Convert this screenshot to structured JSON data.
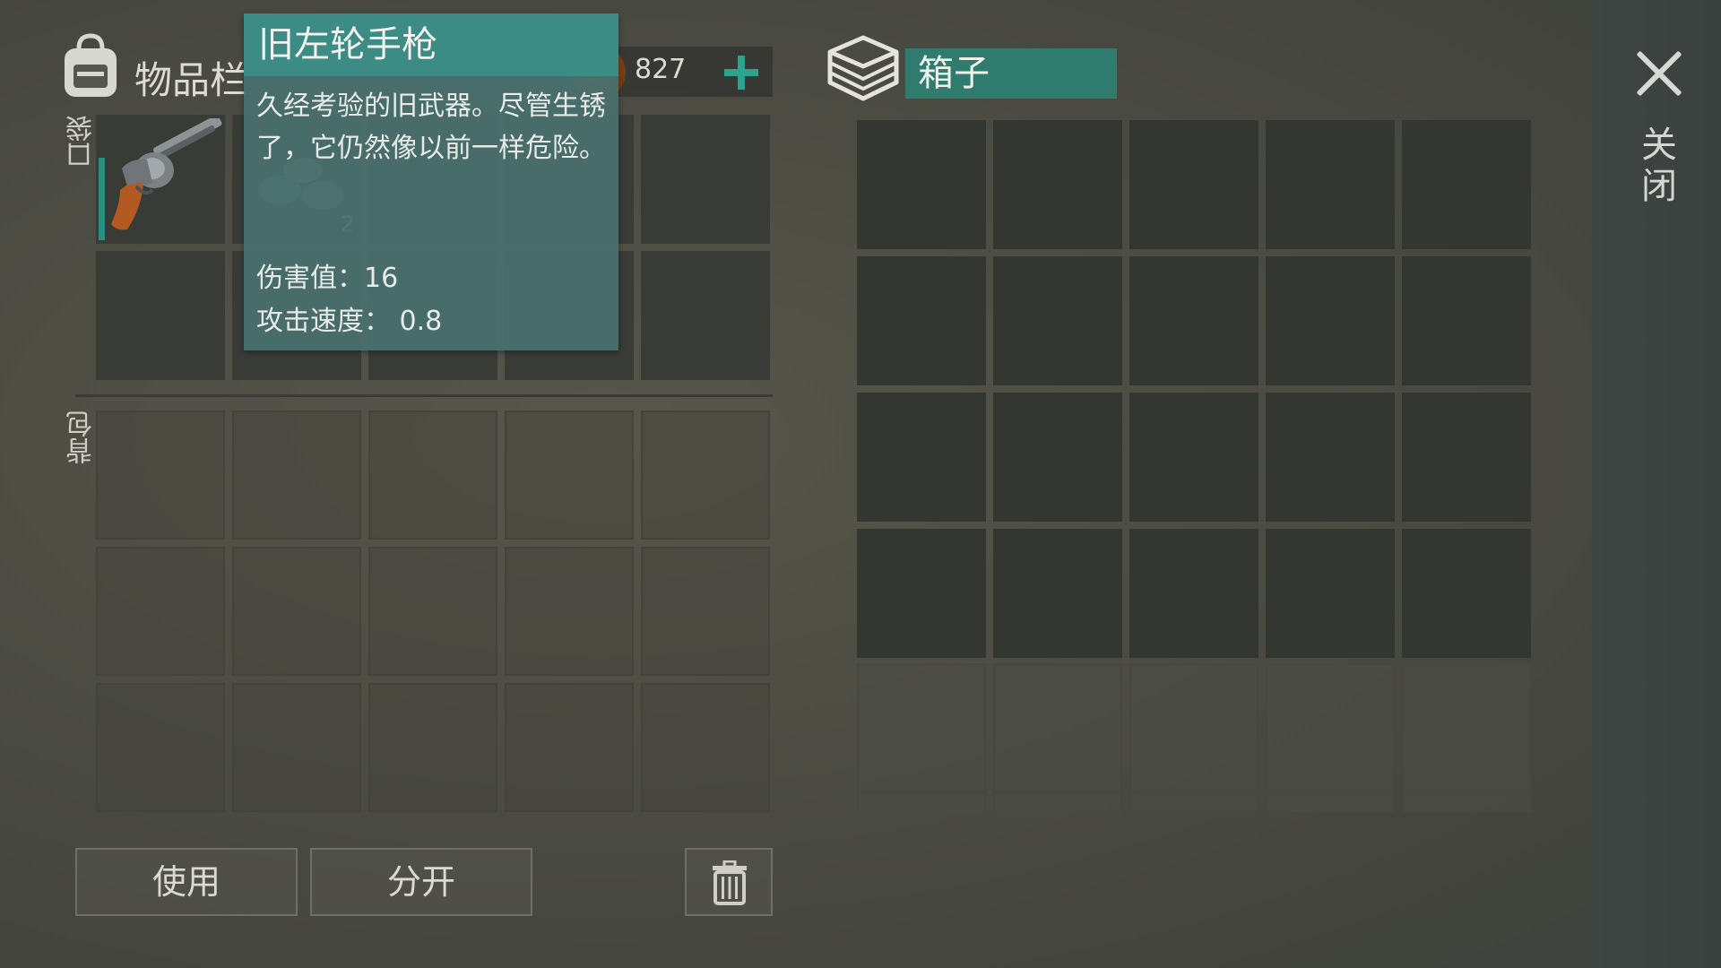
{
  "inventory": {
    "title": "物品栏",
    "pocket_label": "口袋",
    "backpack_label": "背包",
    "coins": "827",
    "pocket_slots": [
      {
        "item": "old-revolver",
        "qty": ""
      },
      {
        "item": "stone",
        "qty": "2"
      },
      {
        "item": "",
        "qty": ""
      },
      {
        "item": "",
        "qty": ""
      },
      {
        "item": "",
        "qty": ""
      },
      {
        "item": "",
        "qty": ""
      },
      {
        "item": "",
        "qty": ""
      },
      {
        "item": "",
        "qty": ""
      },
      {
        "item": "",
        "qty": ""
      },
      {
        "item": "",
        "qty": ""
      }
    ]
  },
  "tooltip": {
    "title": "旧左轮手枪",
    "description": "久经考验的旧武器。尽管生锈了，它仍然像以前一样危险。",
    "damage": "伤害值：16",
    "attack_speed": "攻击速度： 0.8"
  },
  "chest": {
    "title": "箱子"
  },
  "buttons": {
    "use": "使用",
    "split": "分开"
  },
  "close_label": "关闭",
  "colors": {
    "accent_teal": "#2aa38f",
    "tooltip_bg": "#48706e",
    "chest_header": "#2f7c6f"
  },
  "icons": [
    "backpack-icon",
    "coin-icon",
    "plus-icon",
    "box-icon",
    "revolver-icon",
    "stone-icon",
    "trash-icon",
    "close-icon"
  ]
}
